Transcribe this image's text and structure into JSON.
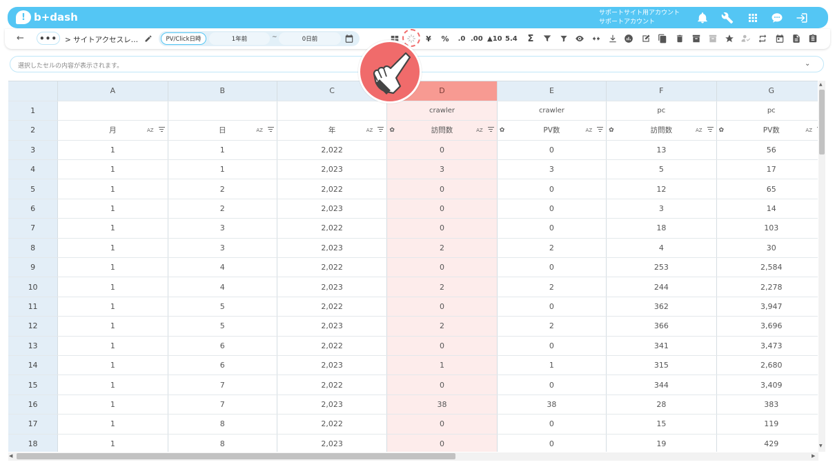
{
  "header": {
    "logo_text": "b+dash",
    "account_line1": "サポートサイト用アカウント",
    "account_line2": "サポートアカウント",
    "icons": [
      "bell-icon",
      "wrench-icon",
      "grid-apps-icon",
      "chat-bubble-icon",
      "logout-icon"
    ]
  },
  "toolbar": {
    "back": "←",
    "more": "•••",
    "breadcrumb": "> サイトアクセスレ…",
    "range_type": "PV/Click日時",
    "range_from": "1年前",
    "range_tilde": "~",
    "range_to": "0日前",
    "format_items": [
      {
        "name": "yen-format",
        "label": "¥"
      },
      {
        "name": "percent-format",
        "label": "%"
      },
      {
        "name": "decrease-decimal",
        "label": ".0"
      },
      {
        "name": "increase-decimal",
        "label": ".00"
      },
      {
        "name": "rank-format",
        "label": "▲10"
      },
      {
        "name": "round-format",
        "label": "5.4"
      },
      {
        "name": "sum-format",
        "label": "Σ"
      }
    ]
  },
  "formula_bar": {
    "placeholder": "選択したセルの内容が表示されます。",
    "chevron": "⌄"
  },
  "grid": {
    "col_letters": [
      "A",
      "B",
      "C",
      "D",
      "E",
      "F",
      "G"
    ],
    "selected_col": "D",
    "group_row": [
      "",
      "",
      "",
      "crawler",
      "crawler",
      "pc",
      "pc"
    ],
    "header_row": [
      "月",
      "日",
      "年",
      "訪問数",
      "PV数",
      "訪問数",
      "PV数"
    ],
    "az_label": "AZ",
    "rows": [
      [
        "3",
        "1",
        "1",
        "2,022",
        "0",
        "0",
        "13",
        "56"
      ],
      [
        "4",
        "1",
        "1",
        "2,023",
        "3",
        "3",
        "5",
        "17"
      ],
      [
        "5",
        "1",
        "2",
        "2,022",
        "0",
        "0",
        "12",
        "65"
      ],
      [
        "6",
        "1",
        "2",
        "2,023",
        "0",
        "0",
        "3",
        "14"
      ],
      [
        "7",
        "1",
        "3",
        "2,022",
        "0",
        "0",
        "18",
        "103"
      ],
      [
        "8",
        "1",
        "3",
        "2,023",
        "2",
        "2",
        "4",
        "30"
      ],
      [
        "9",
        "1",
        "4",
        "2,022",
        "0",
        "0",
        "253",
        "2,584"
      ],
      [
        "10",
        "1",
        "4",
        "2,023",
        "2",
        "2",
        "244",
        "2,278"
      ],
      [
        "11",
        "1",
        "5",
        "2,022",
        "0",
        "0",
        "362",
        "3,947"
      ],
      [
        "12",
        "1",
        "5",
        "2,023",
        "2",
        "2",
        "366",
        "3,696"
      ],
      [
        "13",
        "1",
        "6",
        "2,022",
        "0",
        "0",
        "341",
        "3,473"
      ],
      [
        "14",
        "1",
        "6",
        "2,023",
        "1",
        "1",
        "315",
        "2,680"
      ],
      [
        "15",
        "1",
        "7",
        "2,022",
        "0",
        "0",
        "344",
        "3,409"
      ],
      [
        "16",
        "1",
        "7",
        "2,023",
        "38",
        "38",
        "28",
        "383"
      ],
      [
        "17",
        "1",
        "8",
        "2,022",
        "0",
        "0",
        "15",
        "119"
      ],
      [
        "18",
        "1",
        "8",
        "2,023",
        "0",
        "0",
        "19",
        "429"
      ]
    ],
    "row_labels_top": [
      "1",
      "2"
    ]
  },
  "colors": {
    "brand": "#54c6f4",
    "selected_col_header": "#f79a92",
    "selected_col_cells": "#fdeceb",
    "pointer": "#f06b6b"
  }
}
